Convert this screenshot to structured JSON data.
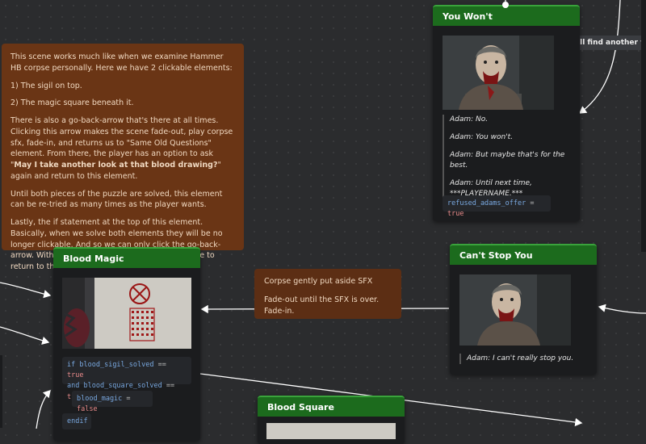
{
  "note_main": {
    "p1": "This scene works much like when we examine Hammer HB corpse personally. Here we have 2 clickable elements:",
    "p2": "1) The sigil on top.",
    "p3": "2) The magic square beneath it.",
    "p4_a": "There is also a go-back-arrow that's there at all times. Clicking this arrow makes the scene fade-out, play corpse sfx, fade-in, and returns us to \"Same Old Questions\" element. From there, the player has an option to ask \"",
    "p4_bold": "May I take another look at that blood drawing?",
    "p4_b": "\" again and return to this element.",
    "p5": "Until both pieces of the puzzle are solved, this element can be re-tried as many times as the player wants.",
    "p6": "Lastly, the if statement at the top of this element. Basically, when we solve both elements they will be no longer clickable. And so we can only click the go-back-arrow. With blood_magic = false, we won't be able to return to this element anymore."
  },
  "note_sfx": {
    "line1": "Corpse gently put aside SFX",
    "line2": "Fade-out until the SFX is over. Fade-in."
  },
  "tooltip": "I'll find another way.",
  "node_you_wont": {
    "title": "You Won't",
    "lines": [
      "Adam: No.",
      "Adam: You won't.",
      "Adam: But maybe that's for the best.",
      "Adam: Until next time,",
      "***PLAYERNAME.***"
    ],
    "code_var": "refused_adams_offer",
    "code_op": "=",
    "code_val": "true"
  },
  "node_cant_stop": {
    "title": "Can't Stop You",
    "line": "Adam: I can't really stop you."
  },
  "node_blood_magic": {
    "title": "Blood Magic",
    "if_kw": "if",
    "cond1_var": "blood_sigil_solved",
    "cond1_op": "==",
    "cond1_val": "true",
    "and_kw": "and",
    "cond2_var": "blood_square_solved",
    "cond2_op": "==",
    "cond2_val": "true",
    "assign_var": "blood_magic",
    "assign_op": "=",
    "assign_val": "false",
    "endif": "endif"
  },
  "node_blood_square": {
    "title": "Blood Square"
  },
  "colors": {
    "header_green": "#1c6b1d",
    "note_brown": "#6a3515",
    "canvas": "#2b2c2e"
  }
}
